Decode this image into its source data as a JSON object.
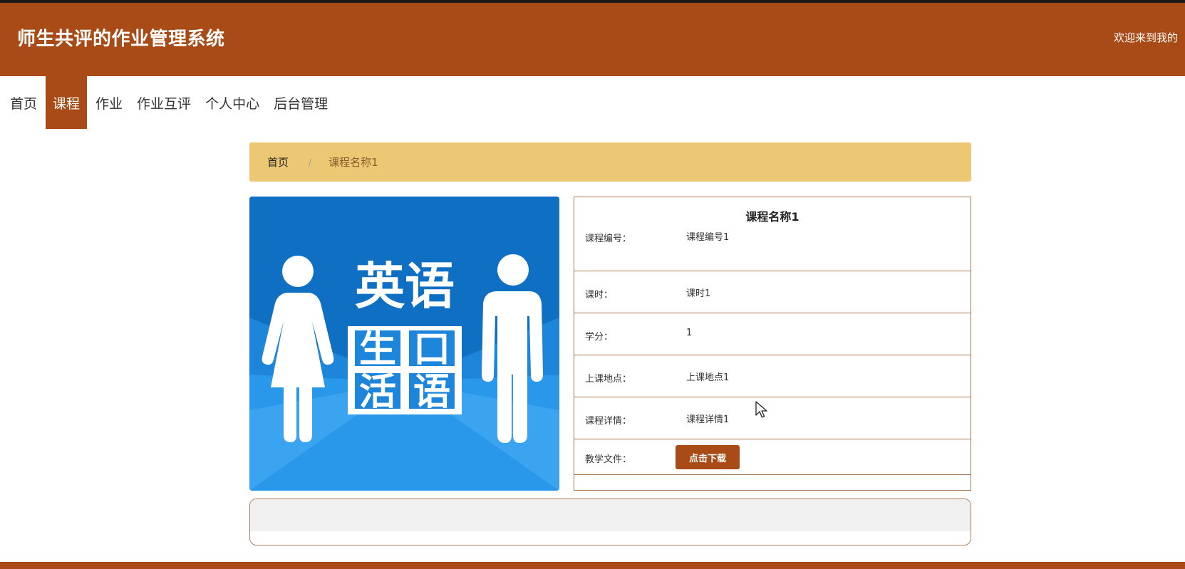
{
  "header": {
    "title": "师生共评的作业管理系统",
    "welcome": "欢迎来到我的"
  },
  "nav": {
    "items": [
      {
        "label": "首页",
        "active": false
      },
      {
        "label": "课程",
        "active": true
      },
      {
        "label": "作业",
        "active": false
      },
      {
        "label": "作业互评",
        "active": false
      },
      {
        "label": "个人中心",
        "active": false
      },
      {
        "label": "后台管理",
        "active": false
      }
    ]
  },
  "breadcrumb": {
    "home": "首页",
    "separator": "/",
    "current": "课程名称1"
  },
  "course_image": {
    "title_line": "英语",
    "subtitle_left": "生活",
    "subtitle_right": "口语",
    "char_1": "生",
    "char_2": "口",
    "char_3": "活",
    "char_4": "语"
  },
  "detail": {
    "title": "课程名称1",
    "rows": [
      {
        "label": "课程编号：",
        "value": "课程编号1"
      },
      {
        "label": "课时：",
        "value": "课时1"
      },
      {
        "label": "学分：",
        "value": "1"
      },
      {
        "label": "上课地点：",
        "value": "上课地点1"
      },
      {
        "label": "课程详情：",
        "value": "课程详情1"
      },
      {
        "label": "教学文件：",
        "button": "点击下载"
      }
    ]
  },
  "colors": {
    "brand": "#a84b17",
    "breadcrumb_bg": "#ecc874",
    "image_blue": "#1a7fd6",
    "border": "#a87650"
  }
}
